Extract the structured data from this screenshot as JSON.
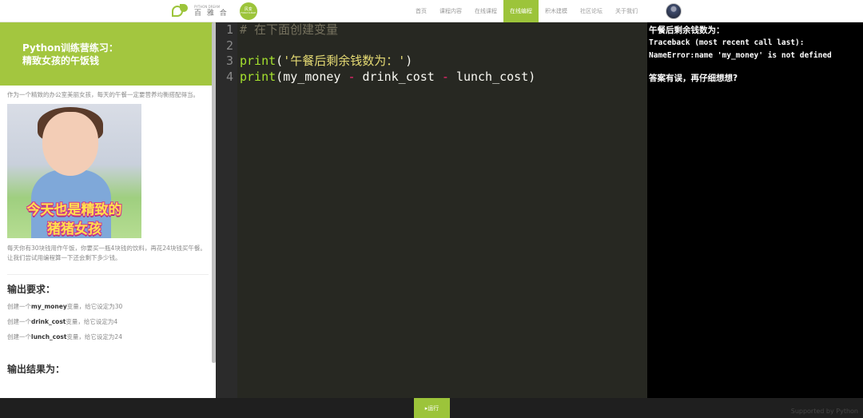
{
  "brand": {
    "name_en": "PYTHON DREAM",
    "name_cn": "百 雅 合",
    "badge_top": "风变",
    "badge_bottom": "FORCHANGE"
  },
  "nav": {
    "items": [
      {
        "label": "首页",
        "active": false
      },
      {
        "label": "课程内容",
        "active": false
      },
      {
        "label": "在线课程",
        "active": false
      },
      {
        "label": "在线编程",
        "active": true
      },
      {
        "label": "积木建模",
        "active": false
      },
      {
        "label": "社区论坛",
        "active": false
      },
      {
        "label": "关于我们",
        "active": false
      }
    ]
  },
  "lesson": {
    "banner_line1": "Python训练营练习：",
    "banner_line2": "精致女孩的午饭钱",
    "intro": "作为一个精致的办公室美丽女孩，每天的午餐一定要营养均衡搭配得当。",
    "image_caption_line1": "今天也是精致的",
    "image_caption_line2": "猪猪女孩",
    "story": "每天你有30块钱用作午饭，你要买一瓶4块钱的饮料，再花24块钱买午餐。让我们尝试用编程算一下还会剩下多少钱。",
    "requirements_heading": "输出要求：",
    "requirements": [
      {
        "prefix": "创建一个",
        "var": "my_money",
        "suffix": "变量，给它设定为30"
      },
      {
        "prefix": "创建一个",
        "var": "drink_cost",
        "suffix": "变量，给它设定为4"
      },
      {
        "prefix": "创建一个",
        "var": "lunch_cost",
        "suffix": "变量，给它设定为24"
      }
    ],
    "result_heading": "输出结果为："
  },
  "editor": {
    "line_numbers": [
      "1",
      "2",
      "3",
      "4"
    ],
    "line1_comment": "# 在下面创建变量",
    "line3_func": "print",
    "line3_open": "(",
    "line3_string": "'午餐后剩余钱数为：'",
    "line3_close": ")",
    "line4_func": "print",
    "line4_open": "(",
    "line4_var1": "my_money",
    "line4_op1": "-",
    "line4_var2": "drink_cost",
    "line4_op2": "-",
    "line4_var3": "lunch_cost",
    "line4_close": ")"
  },
  "console": {
    "title": "午餐后剩余钱数为：",
    "traceback": "Traceback (most recent call last):",
    "error": "NameError:name 'my_money' is not defined",
    "message": "答案有误，再仔细想想?"
  },
  "footer": {
    "run_label": "▸运行",
    "powered_by": "Supported by Python"
  },
  "colors": {
    "accent": "#9cc43a",
    "editor_bg": "#272822",
    "console_bg": "#000000"
  }
}
